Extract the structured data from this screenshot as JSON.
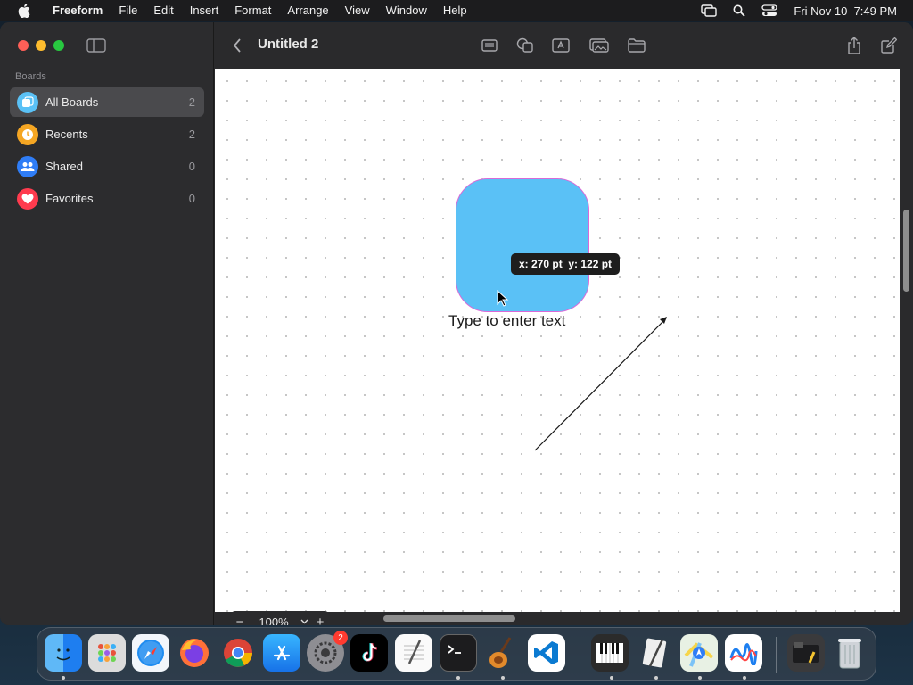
{
  "menubar": {
    "app_name": "Freeform",
    "items": [
      "File",
      "Edit",
      "Insert",
      "Format",
      "Arrange",
      "View",
      "Window",
      "Help"
    ],
    "clock": "Fri Nov 10  7:49 PM"
  },
  "sidebar": {
    "section_title": "Boards",
    "items": [
      {
        "label": "All Boards",
        "count": "2",
        "icon": "boards-icon",
        "color": "#5ac1f6"
      },
      {
        "label": "Recents",
        "count": "2",
        "icon": "clock-icon",
        "color": "#f5a623"
      },
      {
        "label": "Shared",
        "count": "0",
        "icon": "people-icon",
        "color": "#2f7df6"
      },
      {
        "label": "Favorites",
        "count": "0",
        "icon": "heart-icon",
        "color": "#ff3b4e"
      }
    ]
  },
  "toolbar": {
    "title": "Untitled 2"
  },
  "canvas": {
    "shape_text": "Type to enter text",
    "tooltip": "x: 270 pt  y: 122 pt",
    "shape_color": "#5ac1f6"
  },
  "zoom": {
    "value": "100%",
    "minus": "−",
    "plus": "+"
  },
  "dock": {
    "badge_settings": "2",
    "apps": [
      "finder-icon",
      "launchpad-icon",
      "safari-icon",
      "firefox-icon",
      "chrome-icon",
      "app-store-icon",
      "system-settings-icon",
      "tiktok-icon",
      "textedit-icon",
      "terminal-icon",
      "garageband-icon",
      "vscode-icon",
      "piano-icon",
      "script-editor-icon",
      "maps-icon",
      "freeform-icon",
      "downloads-icon",
      "trash-icon"
    ]
  }
}
